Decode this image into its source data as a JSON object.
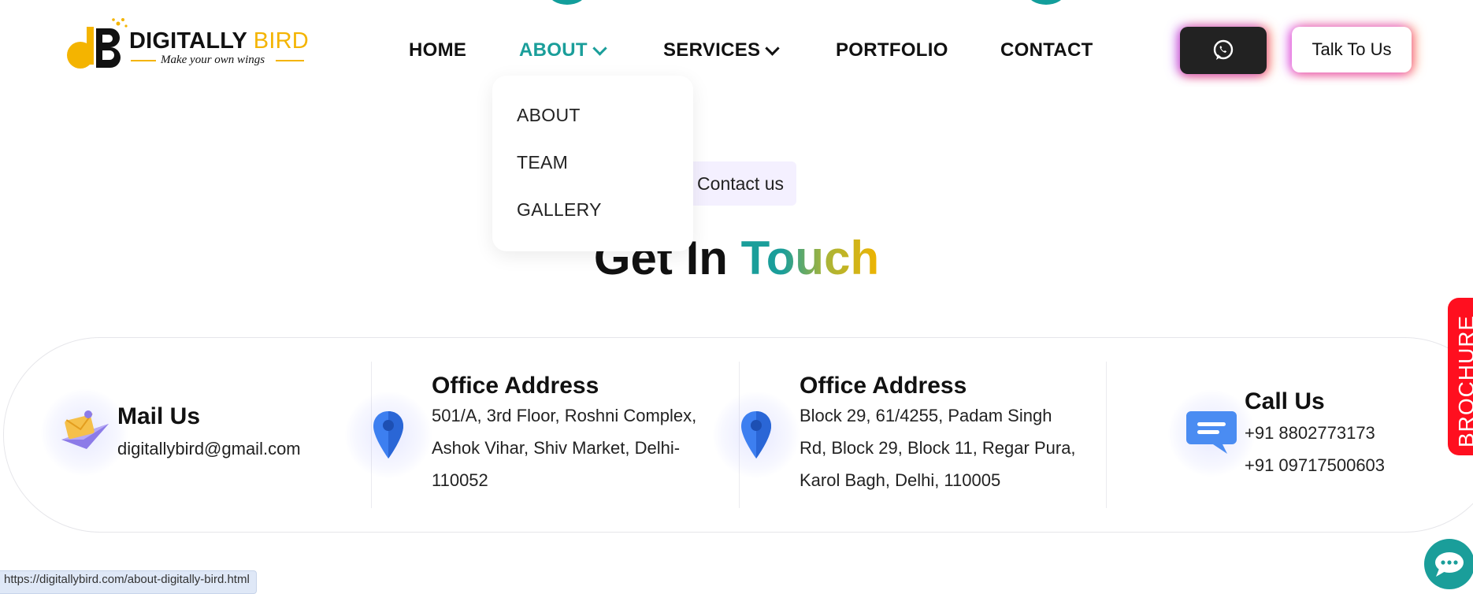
{
  "header": {
    "logo": {
      "brand_primary": "DIGITALLY",
      "brand_secondary": "BIRD",
      "tagline": "Make your own wings"
    },
    "nav": [
      {
        "label": "HOME",
        "active": false,
        "has_dropdown": false
      },
      {
        "label": "ABOUT",
        "active": true,
        "has_dropdown": true
      },
      {
        "label": "SERVICES",
        "active": false,
        "has_dropdown": true
      },
      {
        "label": "PORTFOLIO",
        "active": false,
        "has_dropdown": false
      },
      {
        "label": "CONTACT",
        "active": false,
        "has_dropdown": false
      }
    ],
    "whatsapp_icon": "whatsapp-icon",
    "talk_button": "Talk To Us"
  },
  "dropdown": {
    "items": [
      "ABOUT",
      "TEAM",
      "GALLERY"
    ]
  },
  "hero": {
    "badge": "Contact us",
    "heading_plain": "Get In",
    "heading_accent": "Touch"
  },
  "info": [
    {
      "icon": "mail-icon",
      "title": "Mail Us",
      "lines": [
        "digitallybird@gmail.com"
      ]
    },
    {
      "icon": "map-pin-icon",
      "title": "Office Address",
      "lines": [
        "501/A, 3rd Floor, Roshni Complex,",
        "Ashok Vihar, Shiv Market, Delhi-",
        "110052"
      ]
    },
    {
      "icon": "map-pin-icon",
      "title": "Office Address",
      "lines": [
        "Block 29, 61/4255, Padam Singh",
        "Rd, Block 29, Block 11, Regar Pura,",
        "Karol Bagh, Delhi, 110005"
      ]
    },
    {
      "icon": "chat-bubble-icon",
      "title": "Call Us",
      "lines": [
        "+91 8802773173",
        "+91 09717500603"
      ]
    }
  ],
  "side_tab": "BROCHURE",
  "floating_chat_icon": "chat-dots-icon",
  "status_url": "https://digitallybird.com/about-digitally-bird.html",
  "colors": {
    "accent_teal": "#1a9e9a",
    "accent_gold": "#f4b400",
    "brochure_red": "#ff0f1f",
    "badge_bg": "#f4f0ff"
  }
}
